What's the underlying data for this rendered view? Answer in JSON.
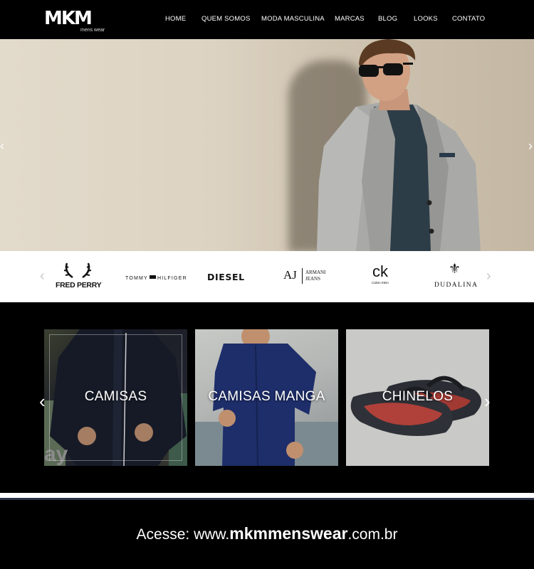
{
  "header": {
    "logo_main": "MKM",
    "logo_sub": "mens wear",
    "nav": [
      "HOME",
      "QUEM SOMOS",
      "MODA MASCULINA",
      "MARCAS",
      "BLOG",
      "LOOKS",
      "CONTATO"
    ]
  },
  "hero": {
    "prev_icon": "chevron-left-icon",
    "next_icon": "chevron-right-icon"
  },
  "brands": {
    "items": [
      {
        "name": "FRED PERRY"
      },
      {
        "name": "TOMMY",
        "name_b": "HILFIGER"
      },
      {
        "name": "DIESEL"
      },
      {
        "name": "AJ",
        "name_b": "ARMANI",
        "name_c": "JEANS"
      },
      {
        "name": "ck",
        "name_b": "Calvin Klein"
      },
      {
        "name": "DUDALINA"
      }
    ]
  },
  "categories": {
    "items": [
      {
        "label": "CAMISAS"
      },
      {
        "label": "CAMISAS MANGA"
      },
      {
        "label": "CHINELOS"
      }
    ]
  },
  "footer": {
    "prefix": "Acesse: www.",
    "domain": "mkmmenswear",
    "suffix": ".com.br"
  }
}
